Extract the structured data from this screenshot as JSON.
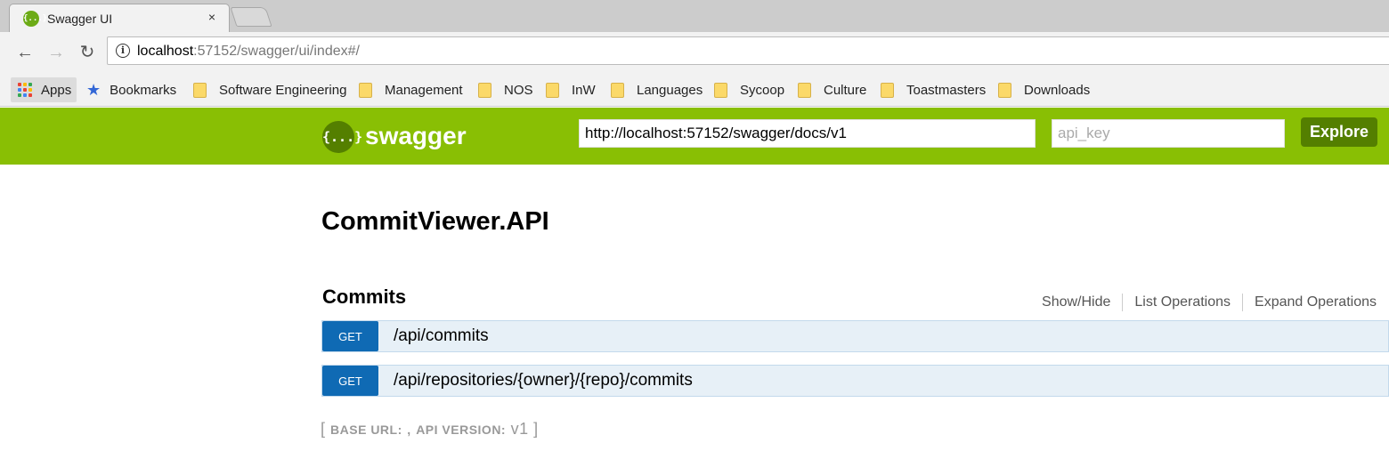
{
  "browser": {
    "tab": {
      "title": "Swagger UI",
      "favicon": "{...}",
      "close": "×"
    },
    "nav": {
      "back": "←",
      "forward": "→",
      "reload": "↻"
    },
    "url": {
      "host": "localhost",
      "rest": ":57152/swagger/ui/index#/"
    },
    "bookmarks": {
      "apps": "Apps",
      "bookmarks": "Bookmarks",
      "folders": [
        "Software Engineering",
        "Management",
        "NOS",
        "InW",
        "Languages",
        "Sycoop",
        "Culture",
        "Toastmasters",
        "Downloads"
      ]
    },
    "icons": {
      "apps": "apps-grid-icon",
      "bookmarks": "star-icon",
      "folder": "folder-icon",
      "info": "info-icon"
    }
  },
  "swagger_header": {
    "logo_text": "{...}",
    "brand": "swagger",
    "spec_url": "http://localhost:57152/swagger/docs/v1",
    "api_key_placeholder": "api_key",
    "explore_label": "Explore",
    "colors": {
      "bar": "#89bf04",
      "dark": "#547f00"
    }
  },
  "api": {
    "title": "CommitViewer.API",
    "resources": [
      {
        "name": "Commits",
        "links": [
          "Show/Hide",
          "List Operations",
          "Expand Operations"
        ],
        "operations": [
          {
            "method": "GET",
            "path": "/api/commits"
          },
          {
            "method": "GET",
            "path": "/api/repositories/{owner}/{repo}/commits"
          }
        ]
      }
    ],
    "footer": {
      "open": "[",
      "base_url_label": "BASE URL:",
      "sep": ",",
      "api_version_label": "API VERSION:",
      "version": "v1",
      "close": "]"
    },
    "colors": {
      "get": "#0f6ab4",
      "op_bg": "#e7f0f7"
    }
  }
}
